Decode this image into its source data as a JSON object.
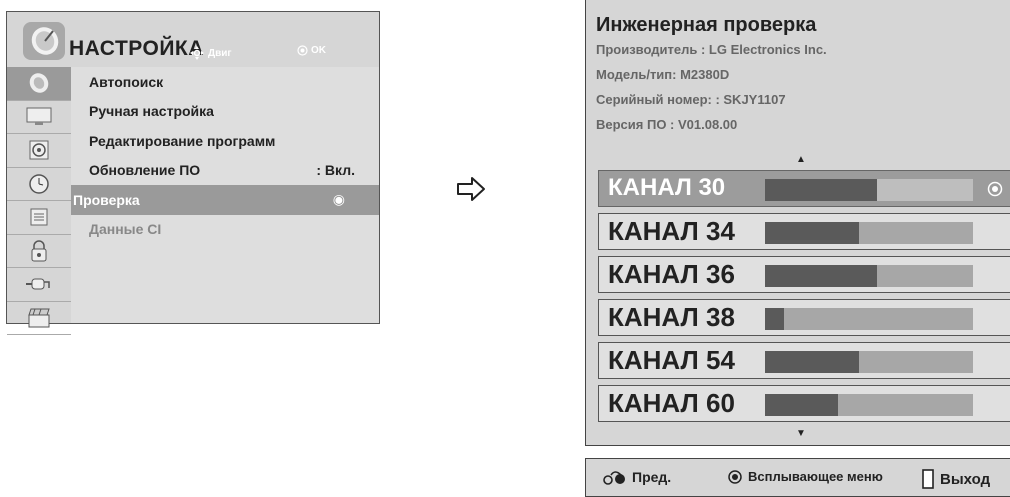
{
  "settings_menu": {
    "title": "НАСТРОЙКА",
    "move_hint": "Двиг",
    "ok_hint": "OK",
    "sidebar_icons": [
      "satellite-dish-icon",
      "monitor-icon",
      "speaker-icon",
      "clock-icon",
      "lock-list-icon",
      "padlock-icon",
      "connector-icon",
      "clapperboard-icon"
    ],
    "items": [
      {
        "label": "Автопоиск",
        "value": ""
      },
      {
        "label": "Ручная настройка",
        "value": ""
      },
      {
        "label": "Редактирование программ",
        "value": ""
      },
      {
        "label": "Обновление ПО",
        "value": ": Вкл."
      },
      {
        "label": "Проверка",
        "value": "◉"
      },
      {
        "label": "Данные CI",
        "value": ""
      }
    ]
  },
  "diagnostics": {
    "title": "Инженерная проверка",
    "manufacturer": "Производитель : LG Electronics Inc.",
    "model": "Модель/тип: M2380D",
    "serial": "Серийный номер: : SKJY1107",
    "software": "Версия ПО : V01.08.00",
    "scroll_up": "▲",
    "scroll_down": "▼",
    "channels": [
      {
        "label": "КАНАЛ 30",
        "signal": 0.54
      },
      {
        "label": "КАНАЛ 34",
        "signal": 0.45
      },
      {
        "label": "КАНАЛ 36",
        "signal": 0.54
      },
      {
        "label": "КАНАЛ 38",
        "signal": 0.09
      },
      {
        "label": "КАНАЛ 54",
        "signal": 0.45
      },
      {
        "label": "КАНАЛ 60",
        "signal": 0.35
      }
    ]
  },
  "footer": {
    "prev_label": "Пред.",
    "popup_label": "Всплывающее меню",
    "exit_label": "Выход"
  },
  "colors": {
    "panel_bg": "#d6d6d6",
    "selected_bg": "#9a9a9a",
    "bar_fill": "#5a5a5a",
    "bar_track": "#a7a7a7"
  }
}
